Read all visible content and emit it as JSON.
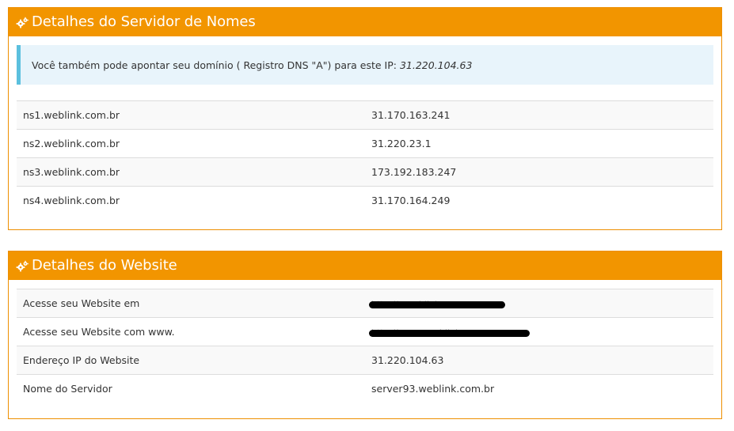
{
  "nameserver_panel": {
    "title": "Detalhes do Servidor de Nomes",
    "icon": "gears-icon",
    "alert_text": "Você também pode apontar seu domínio ( Registro DNS \"A\") para este IP:",
    "alert_ip": "31.220.104.63",
    "rows": [
      {
        "name": "ns1.weblink.com.br",
        "ip": "31.170.163.241"
      },
      {
        "name": "ns2.weblink.com.br",
        "ip": "31.220.23.1"
      },
      {
        "name": "ns3.weblink.com.br",
        "ip": "173.192.183.247"
      },
      {
        "name": "ns4.weblink.com.br",
        "ip": "31.170.164.249"
      }
    ]
  },
  "website_panel": {
    "title": "Detalhes do Website",
    "icon": "gears-icon",
    "rows": [
      {
        "label": "Acesse seu Website em",
        "value": "http://...weblink...",
        "redacted": true
      },
      {
        "label": "Acesse seu Website com www.",
        "value": "http://www...weblink...",
        "redacted": true
      },
      {
        "label": "Endereço IP do Website",
        "value": "31.220.104.63"
      },
      {
        "label": "Nome do Servidor",
        "value": "server93.weblink.com.br"
      }
    ]
  },
  "colors": {
    "header": "#f29500",
    "border": "#ee8f00",
    "alert_bg": "#e8f4fb",
    "alert_border": "#5bc0de",
    "redaction": "#000000"
  }
}
